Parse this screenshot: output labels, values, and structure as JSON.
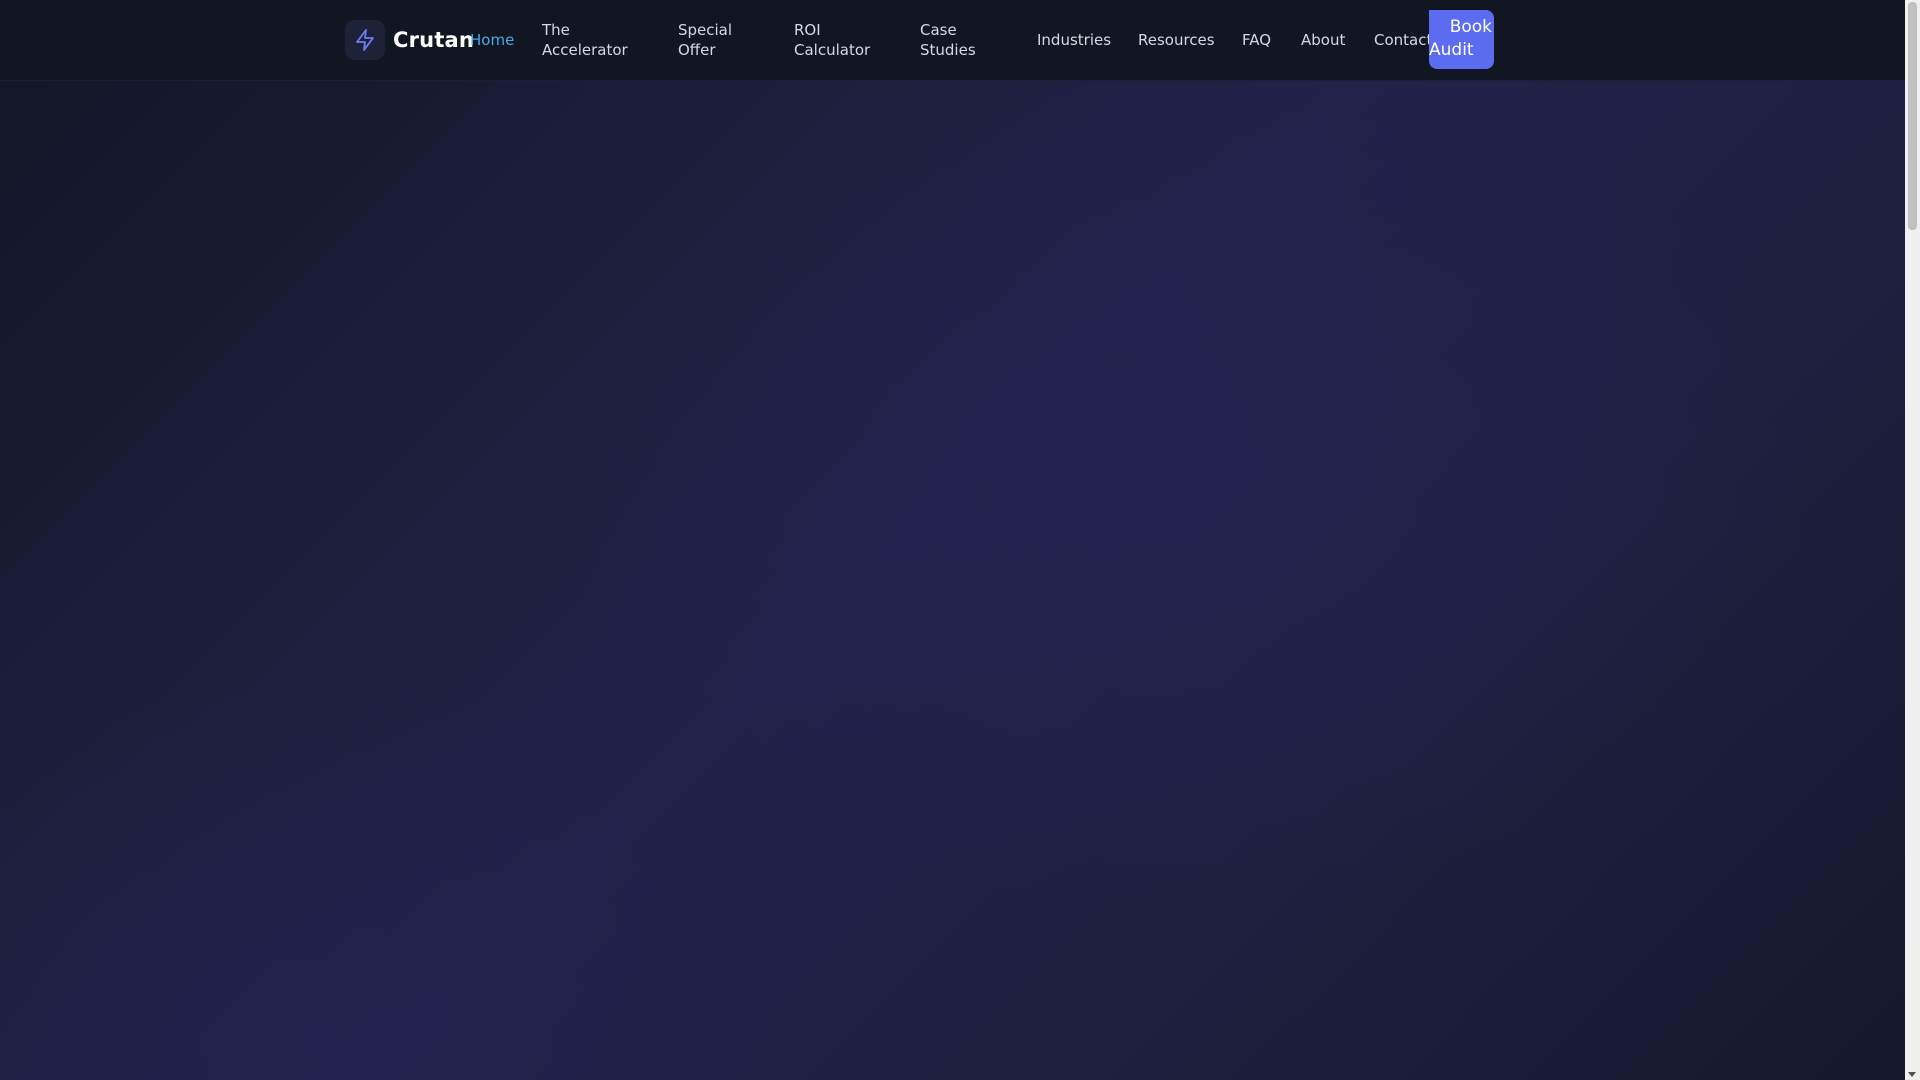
{
  "brand": {
    "name": "Crutan",
    "icon": "lightning-bolt-icon",
    "accent_color": "#5b6cf0"
  },
  "nav": {
    "home": "Home",
    "accelerator": [
      "The",
      "Accelerator"
    ],
    "special_offer": [
      "Special",
      "Offer"
    ],
    "roi_calculator": [
      "ROI",
      "Calculator"
    ],
    "case_studies": [
      "Case",
      "Studies"
    ],
    "industries": "Industries",
    "resources": "Resources",
    "faq": "FAQ",
    "about": "About",
    "contact": "Contact",
    "active_color": "#4aa8e8"
  },
  "cta": {
    "line1": "Book",
    "line2": "Audit"
  }
}
